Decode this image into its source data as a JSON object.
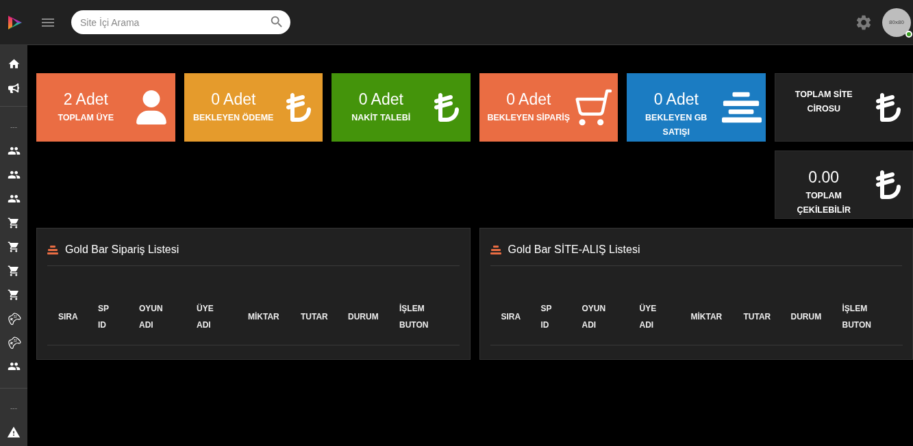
{
  "header": {
    "search": {
      "placeholder": "Site İçi Arama"
    },
    "avatar": {
      "label": "80x80",
      "online": true
    }
  },
  "sidebar": {
    "sections": [
      {
        "items": [
          {
            "kind": "home"
          },
          {
            "kind": "megaphone"
          }
        ]
      },
      {
        "heading": "---",
        "items": [
          {
            "kind": "users"
          },
          {
            "kind": "users"
          },
          {
            "kind": "users"
          },
          {
            "kind": "cart"
          },
          {
            "kind": "cart"
          },
          {
            "kind": "cart"
          },
          {
            "kind": "cart"
          },
          {
            "kind": "gamepad"
          },
          {
            "kind": "gamepad"
          },
          {
            "kind": "users"
          }
        ]
      },
      {
        "heading": "---",
        "items": [
          {
            "kind": "warning"
          }
        ]
      }
    ]
  },
  "stat_cards": [
    {
      "value": "2 Adet",
      "label": "TOPLAM ÜYE",
      "color": "#ea6d43",
      "kind": "user"
    },
    {
      "value": "0 Adet",
      "label": "BEKLEYEN ÖDEME",
      "color": "#e59b2c",
      "kind": "lira"
    },
    {
      "value": "0 Adet",
      "label": "NAKİT TALEBİ",
      "color": "#44940b",
      "kind": "lira"
    },
    {
      "value": "0 Adet",
      "label": "BEKLEYEN SİPARİŞ",
      "color": "#ea6d43",
      "kind": "cart"
    },
    {
      "value": "0 Adet",
      "label": "BEKLEYEN GB SATIŞI",
      "color": "#1b7cc2",
      "kind": "bars"
    }
  ],
  "totals": [
    {
      "label": "TOPLAM SİTE CİROSU"
    },
    {
      "value": "0.00",
      "label": "TOPLAM ÇEKİLEBİLİR"
    }
  ],
  "panels": [
    {
      "title": "Gold Bar Sipariş Listesi",
      "columns": [
        "SIRA",
        "SP ID",
        "OYUN ADI",
        "ÜYE ADI",
        "MİKTAR",
        "TUTAR",
        "DURUM",
        "İŞLEM BUTON"
      ]
    },
    {
      "title": "Gold Bar SİTE-ALIŞ Listesi",
      "columns": [
        "SIRA",
        "SP ID",
        "OYUN ADI",
        "ÜYE ADI",
        "MİKTAR",
        "TUTAR",
        "DURUM",
        "İŞLEM BUTON"
      ]
    }
  ]
}
